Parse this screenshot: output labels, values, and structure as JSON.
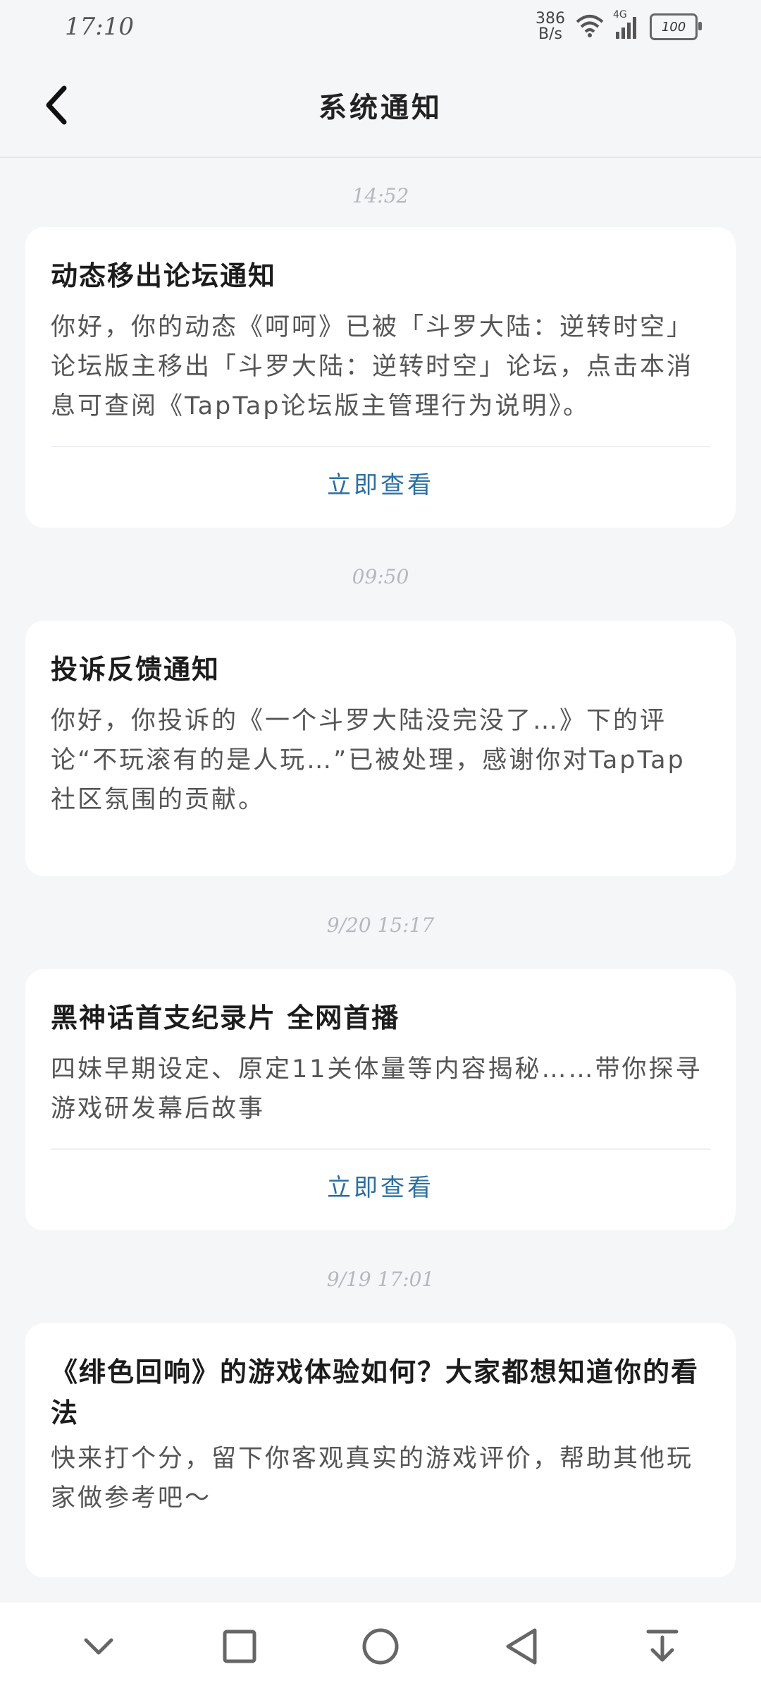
{
  "status_bar": {
    "time": "17:10",
    "net_speed_value": "386",
    "net_speed_unit": "B/s",
    "network_type": "4G",
    "battery": "100"
  },
  "header": {
    "title": "系统通知",
    "back_icon": "chevron-left-icon"
  },
  "notifications": [
    {
      "time": "14:52",
      "title": "动态移出论坛通知",
      "body": "你好，你的动态《呵呵》已被「斗罗大陆：逆转时空」论坛版主移出「斗罗大陆：逆转时空」论坛，点击本消息可查阅《TapTap论坛版主管理行为说明》。",
      "action": "立即查看"
    },
    {
      "time": "09:50",
      "title": "投诉反馈通知",
      "body": "你好，你投诉的《一个斗罗大陆没完没了…》下的评论“不玩滚有的是人玩…”已被处理，感谢你对TapTap 社区氛围的贡献。",
      "action": ""
    },
    {
      "time": "9/20 15:17",
      "title": "黑神话首支纪录片 全网首播",
      "body": "四妹早期设定、原定11关体量等内容揭秘……带你探寻游戏研发幕后故事",
      "action": "立即查看"
    },
    {
      "time": "9/19 17:01",
      "title": "《绯色回响》的游戏体验如何？大家都想知道你的看法",
      "body": "快来打个分，留下你客观真实的游戏评价，帮助其他玩家做参考吧～",
      "action": ""
    }
  ],
  "bottom_nav": {
    "icons": [
      "chevron-down-icon",
      "square-icon",
      "circle-icon",
      "triangle-back-icon",
      "collapse-icon"
    ]
  },
  "colors": {
    "background": "#f5f6f8",
    "card": "#ffffff",
    "action_text": "#2c6fa0",
    "time_label": "#b4b8be"
  }
}
